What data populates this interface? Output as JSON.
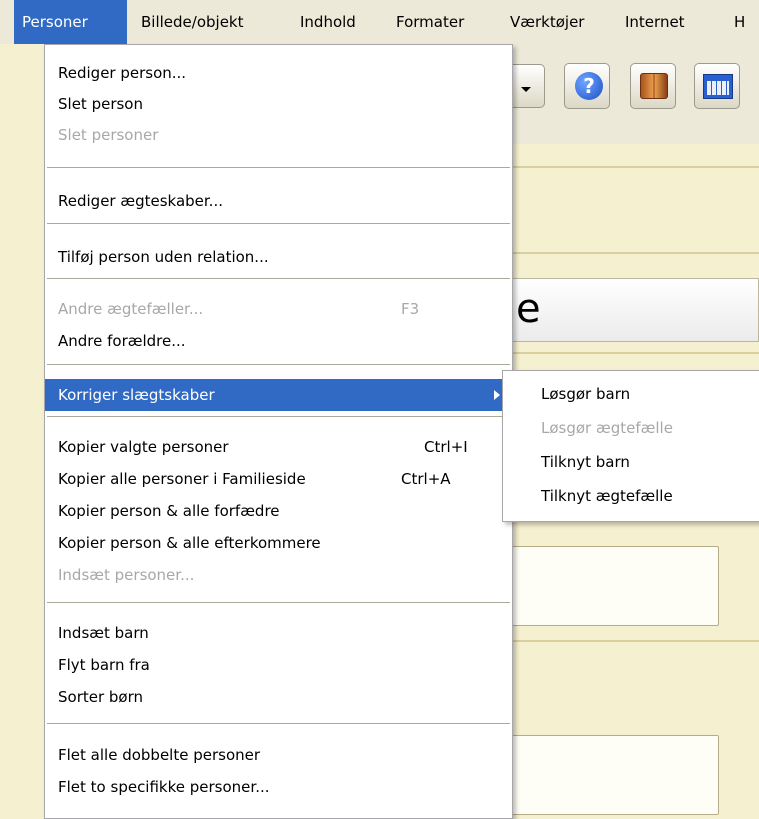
{
  "menubar": {
    "items": [
      {
        "label": "Personer",
        "active": true
      },
      {
        "label": "Billede/objekt"
      },
      {
        "label": "Indhold"
      },
      {
        "label": "Formater"
      },
      {
        "label": "Værktøjer"
      },
      {
        "label": "Internet"
      },
      {
        "label": "H"
      }
    ]
  },
  "toolbar": {
    "icons": [
      "dropdown-arrow-icon",
      "help-icon",
      "book-icon",
      "calendar-icon"
    ],
    "help_glyph": "?"
  },
  "background": {
    "title_fragment": "e"
  },
  "menu": {
    "items": [
      {
        "label": "Rediger person...",
        "disabled": false
      },
      {
        "label": "Slet person",
        "disabled": false
      },
      {
        "label": "Slet personer",
        "disabled": true
      },
      {
        "label": "Rediger ægteskaber...",
        "disabled": false
      },
      {
        "label": "Tilføj person uden relation...",
        "disabled": false
      },
      {
        "label": "Andre ægtefæller...",
        "shortcut": "F3",
        "disabled": true
      },
      {
        "label": "Andre forældre...",
        "disabled": false
      },
      {
        "label": "Korriger slægtskaber",
        "disabled": false,
        "highlighted": true,
        "has_submenu": true
      },
      {
        "label": "Kopier valgte personer",
        "shortcut": "Ctrl+I",
        "disabled": false
      },
      {
        "label": "Kopier alle personer i Familieside",
        "shortcut": "Ctrl+A",
        "disabled": false
      },
      {
        "label": "Kopier person & alle forfædre",
        "disabled": false
      },
      {
        "label": "Kopier person & alle efterkommere",
        "disabled": false
      },
      {
        "label": "Indsæt personer...",
        "disabled": true
      },
      {
        "label": "Indsæt barn",
        "disabled": false
      },
      {
        "label": "Flyt barn fra",
        "disabled": false
      },
      {
        "label": "Sorter børn",
        "disabled": false
      },
      {
        "label": "Flet alle dobbelte personer",
        "disabled": false
      },
      {
        "label": "Flet to specifikke personer...",
        "disabled": false
      }
    ]
  },
  "submenu": {
    "items": [
      {
        "label": "Løsgør barn",
        "disabled": false
      },
      {
        "label": "Løsgør ægtefælle",
        "disabled": true
      },
      {
        "label": "Tilknyt barn",
        "disabled": false
      },
      {
        "label": "Tilknyt ægtefælle",
        "disabled": false
      }
    ]
  },
  "colors": {
    "highlight": "#316ac5",
    "menubar": "#ece9d8",
    "disabled_text": "#a8a8a8",
    "app_background": "#f5f0cf"
  }
}
